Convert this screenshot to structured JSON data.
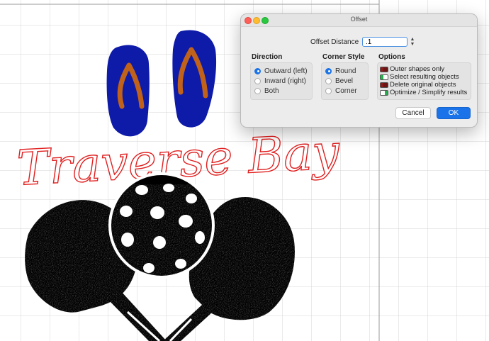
{
  "dialog": {
    "title": "Offset",
    "offset_distance_label": "Offset Distance",
    "offset_distance_value": ".1",
    "direction": {
      "label": "Direction",
      "options": [
        "Outward (left)",
        "Inward (right)",
        "Both"
      ],
      "selected": "Outward (left)"
    },
    "corner_style": {
      "label": "Corner Style",
      "options": [
        "Round",
        "Bevel",
        "Corner"
      ],
      "selected": "Round"
    },
    "options": {
      "label": "Options",
      "items": [
        {
          "label": "Outer shapes only",
          "state": "off"
        },
        {
          "label": "Select resulting objects",
          "state": "off-light"
        },
        {
          "label": "Delete original objects",
          "state": "off"
        },
        {
          "label": "Optimize / Simplify results",
          "state": "on"
        }
      ]
    },
    "cancel_label": "Cancel",
    "ok_label": "OK"
  },
  "artwork": {
    "text": "Traverse Bay",
    "colors": {
      "flip_flop": "#0e1aa8",
      "strap": "#c0621a",
      "text_outline": "#e02020",
      "ink": "#000000",
      "grid": "#d4d4d4",
      "accent": "#1a73e8"
    }
  }
}
